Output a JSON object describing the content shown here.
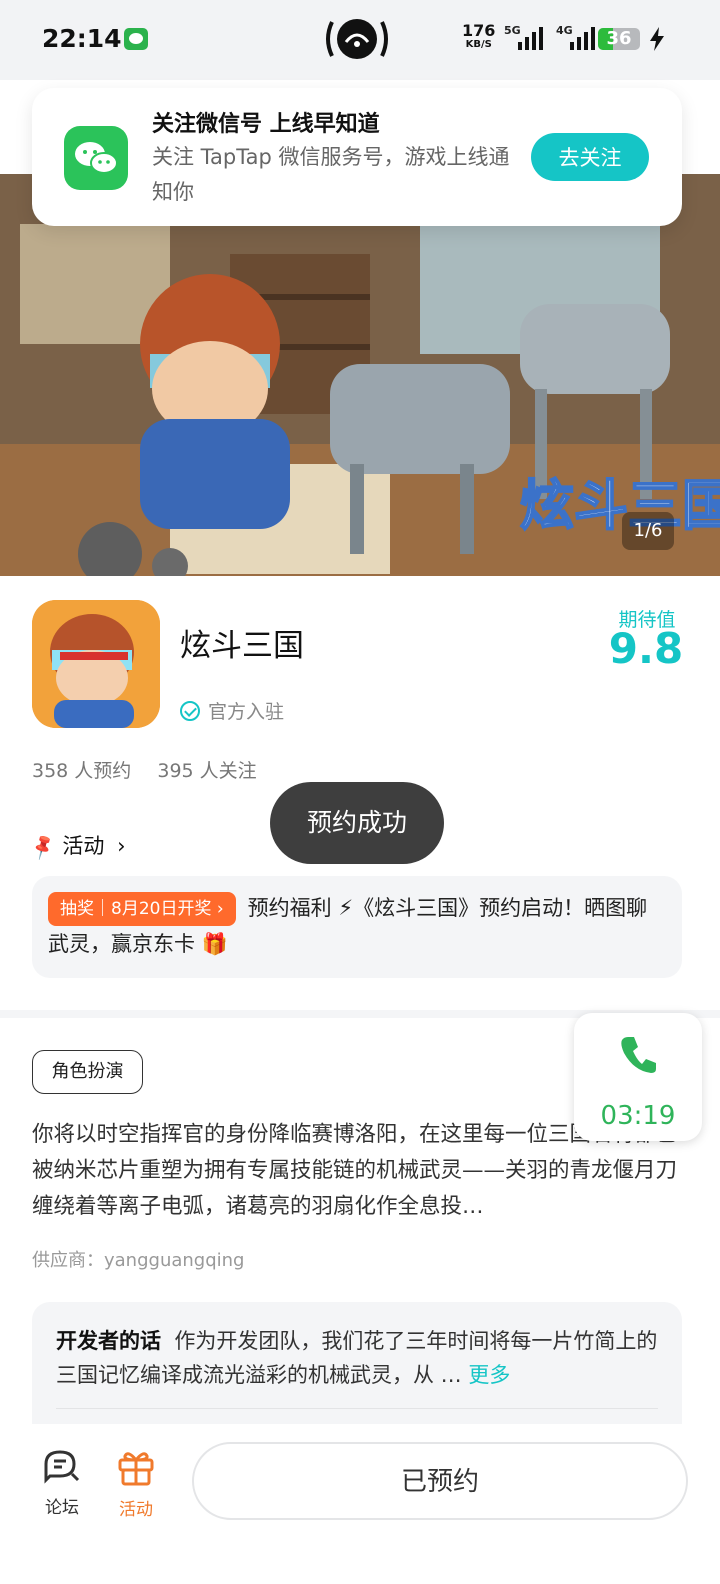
{
  "status_bar": {
    "time": "22:14",
    "network_speed_value": "176",
    "network_speed_unit": "KB/S",
    "signal_1_label": "5G",
    "signal_2_label": "4G",
    "battery_level": "36",
    "battery_percent": 36,
    "icons": [
      "wechat-icon",
      "hotspot-icon",
      "signal-icon",
      "battery-icon",
      "charging-icon"
    ]
  },
  "wechat_card": {
    "title": "关注微信号 上线早知道",
    "description": "关注 TapTap 微信服务号，游戏上线通知你",
    "follow_button": "去关注"
  },
  "hero": {
    "title_art": "炫斗三国",
    "counter": "1/6"
  },
  "game": {
    "name": "炫斗三国",
    "official_label": "官方入驻",
    "expect_label": "期待值",
    "expect_value": "9.8",
    "reservations": "358 人预约",
    "followers": "395 人关注"
  },
  "activity": {
    "header": "活动",
    "tag": "抽奖｜8月20日开奖",
    "text": "预约福利 ⚡《炫斗三国》预约启动！晒图聊武灵，赢京东卡 🎁"
  },
  "toast": "预约成功",
  "call": {
    "duration": "03:19"
  },
  "details": {
    "genre_tag": "角色扮演",
    "description": "你将以时空指挥官的身份降临赛博洛阳，在这里每一位三国名将都已被纳米芯片重塑为拥有专属技能链的机械武灵——关羽的青龙偃月刀缠绕着等离子电弧，诸葛亮的羽扇化作全息投…",
    "supplier": "供应商：yangguangqing"
  },
  "developer_note": {
    "label": "开发者的话",
    "text": "作为开发团队，我们花了三年时间将每一片竹简上的三国记忆编译成流光溢彩的机械武灵，从 …",
    "more": "更多"
  },
  "bottom_nav": {
    "forum": "论坛",
    "activity": "活动",
    "reserved_button": "已预约"
  },
  "colors": {
    "accent": "#15c5c6",
    "activity_orange": "#ff6a2c",
    "call_green": "#2fb45a",
    "wechat_green": "#2bc35a"
  }
}
